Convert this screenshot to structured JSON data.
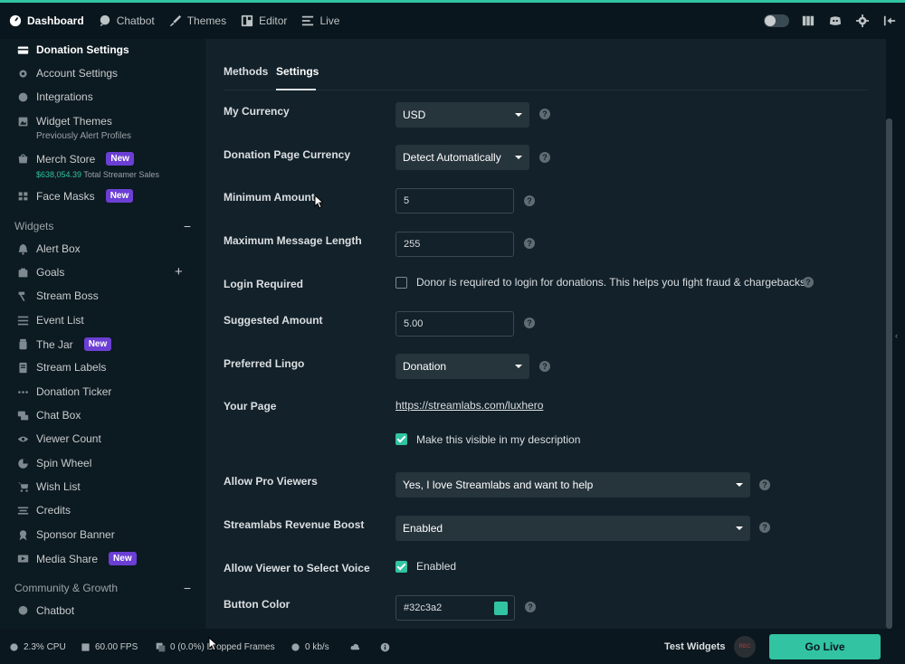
{
  "colors": {
    "accent": "#31c3a2",
    "badge": "#6b3fd4",
    "background": "#12212a"
  },
  "topbar": {
    "items": [
      {
        "label": "Dashboard",
        "icon": "dashboard-icon"
      },
      {
        "label": "Chatbot",
        "icon": "chat-bubble-icon"
      },
      {
        "label": "Themes",
        "icon": "brush-icon"
      },
      {
        "label": "Editor",
        "icon": "layout-icon"
      },
      {
        "label": "Live",
        "icon": "list-icon"
      }
    ]
  },
  "sidebar": {
    "items": [
      {
        "label": "Donation Settings",
        "icon": "donation-icon"
      },
      {
        "label": "Account Settings",
        "icon": "gear-icon"
      },
      {
        "label": "Integrations",
        "icon": "globe-icon"
      },
      {
        "label": "Widget Themes",
        "icon": "image-icon",
        "sub": "Previously Alert Profiles"
      },
      {
        "label": "Merch Store",
        "icon": "store-icon",
        "badge": "New",
        "sub_money": "$638,054.39",
        "sub": "Total Streamer Sales"
      },
      {
        "label": "Face Masks",
        "icon": "mask-icon",
        "badge": "New"
      }
    ],
    "widgets_title": "Widgets",
    "widgets": [
      {
        "label": "Alert Box"
      },
      {
        "label": "Goals"
      },
      {
        "label": "Stream Boss"
      },
      {
        "label": "Event List"
      },
      {
        "label": "The Jar",
        "badge": "New"
      },
      {
        "label": "Stream Labels"
      },
      {
        "label": "Donation Ticker"
      },
      {
        "label": "Chat Box"
      },
      {
        "label": "Viewer Count"
      },
      {
        "label": "Spin Wheel"
      },
      {
        "label": "Wish List"
      },
      {
        "label": "Credits"
      },
      {
        "label": "Sponsor Banner"
      },
      {
        "label": "Media Share",
        "badge": "New"
      }
    ],
    "community_title": "Community & Growth",
    "community": [
      {
        "label": "Chatbot"
      }
    ]
  },
  "main": {
    "tabs": [
      {
        "label": "Methods"
      },
      {
        "label": "Settings"
      }
    ],
    "fields": {
      "currency": {
        "label": "My Currency",
        "value": "USD"
      },
      "page_currency": {
        "label": "Donation Page Currency",
        "value": "Detect Automatically"
      },
      "min_amount": {
        "label": "Minimum Amount",
        "value": "5"
      },
      "max_msg": {
        "label": "Maximum Message Length",
        "value": "255"
      },
      "login": {
        "label": "Login Required",
        "text": "Donor is required to login for donations. This helps you fight fraud & chargebacks.",
        "checked": false
      },
      "suggested": {
        "label": "Suggested Amount",
        "value": "5.00"
      },
      "lingo": {
        "label": "Preferred Lingo",
        "value": "Donation"
      },
      "your_page": {
        "label": "Your Page",
        "url": "https://streamlabs.com/luxhero",
        "visible_text": "Make this visible in my description",
        "checked": true
      },
      "pro_viewers": {
        "label": "Allow Pro Viewers",
        "value": "Yes, I love Streamlabs and want to help"
      },
      "revenue_boost": {
        "label": "Streamlabs Revenue Boost",
        "value": "Enabled"
      },
      "select_voice": {
        "label": "Allow Viewer to Select Voice",
        "text": "Enabled",
        "checked": true
      },
      "button_color": {
        "label": "Button Color",
        "value": "#32c3a2"
      }
    }
  },
  "statusbar": {
    "cpu": "2.3% CPU",
    "fps": "60.00 FPS",
    "dropped": "0 (0.0%) Dropped Frames",
    "bitrate": "0 kb/s",
    "test_widgets": "Test Widgets",
    "rec": "REC",
    "go_live": "Go Live"
  }
}
